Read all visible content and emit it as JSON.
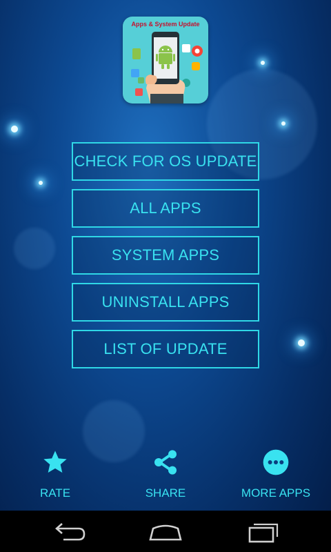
{
  "app_icon": {
    "title": "Apps & System Update",
    "icon": "android-phone-update-icon"
  },
  "menu": {
    "items": [
      {
        "label": "CHECK FOR OS UPDATE"
      },
      {
        "label": "ALL APPS"
      },
      {
        "label": "SYSTEM APPS"
      },
      {
        "label": "UNINSTALL APPS"
      },
      {
        "label": "LIST OF UPDATE"
      }
    ]
  },
  "bottom_bar": {
    "rate": {
      "label": "RATE",
      "icon": "star-icon"
    },
    "share": {
      "label": "SHARE",
      "icon": "share-icon"
    },
    "more_apps": {
      "label": "MORE APPS",
      "icon": "more-dots-icon"
    }
  },
  "system_nav": {
    "back": {
      "icon": "back-icon"
    },
    "home": {
      "icon": "home-icon"
    },
    "recents": {
      "icon": "recents-icon"
    }
  },
  "colors": {
    "accent": "#39e2f0",
    "background_top": "#1f6fbf",
    "background_bottom": "#031b44",
    "app_icon_bg": "#56cfd7",
    "app_icon_title": "#c4122f"
  }
}
